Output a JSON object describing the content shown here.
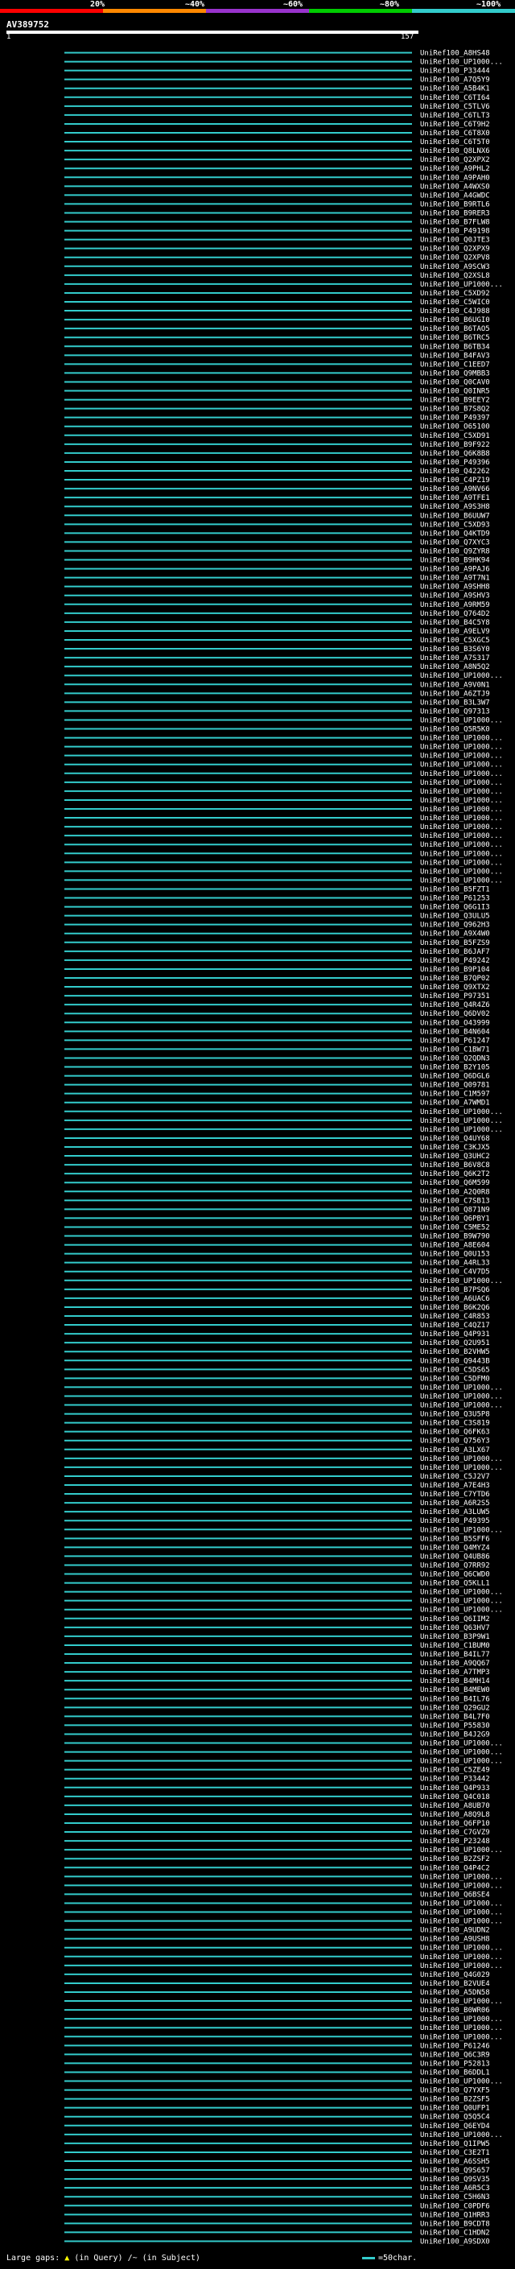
{
  "query": {
    "name": "AV389752",
    "start": "1",
    "end": "157"
  },
  "legend": {
    "labels": [
      "20%",
      "~40%",
      "~60%",
      "~80%",
      "~100%"
    ],
    "colors": [
      "#ff0000",
      "#ff8800",
      "#9933cc",
      "#00cc00",
      "#33cccc"
    ]
  },
  "chart_data": {
    "type": "alignment",
    "query_length": 157,
    "hits": [
      "UniRef100_A8HS48",
      "UniRef100_UP1000...",
      "UniRef100_P33444",
      "UniRef100_A7Q5Y9",
      "UniRef100_A5B4K1",
      "UniRef100_C6TI64",
      "UniRef100_C5TLV6",
      "UniRef100_C6TLT3",
      "UniRef100_C6T9H2",
      "UniRef100_C6T8X0",
      "UniRef100_C6T5T0",
      "UniRef100_Q8LNX6",
      "UniRef100_Q2XPX2",
      "UniRef100_A9PHL2",
      "UniRef100_A9PAH0",
      "UniRef100_A4WXS0",
      "UniRef100_A4GWDC",
      "UniRef100_B9RTL6",
      "UniRef100_B9RER3",
      "UniRef100_B7FLW8",
      "UniRef100_P49198",
      "UniRef100_Q0JTE3",
      "UniRef100_Q2XPX9",
      "UniRef100_Q2XPV8",
      "UniRef100_A9SCW3",
      "UniRef100_Q2XSL8",
      "UniRef100_UP1000...",
      "UniRef100_C5XD92",
      "UniRef100_C5WIC0",
      "UniRef100_C4J988",
      "UniRef100_B6UGI0",
      "UniRef100_B6TAO5",
      "UniRef100_B6TRC5",
      "UniRef100_B6TB34",
      "UniRef100_B4FAV3",
      "UniRef100_C1EED7",
      "UniRef100_Q9MBB3",
      "UniRef100_Q0CAV0",
      "UniRef100_Q0INR5",
      "UniRef100_B9EEY2",
      "UniRef100_B7S8Q2",
      "UniRef100_P49397",
      "UniRef100_O65100",
      "UniRef100_C5XD91",
      "UniRef100_B9F922",
      "UniRef100_Q6K8B8",
      "UniRef100_P49396",
      "UniRef100_Q42262",
      "UniRef100_C4PZ19",
      "UniRef100_A9NV66",
      "UniRef100_A9TFE1",
      "UniRef100_A9S3H8",
      "UniRef100_B6UUW7",
      "UniRef100_C5XD93",
      "UniRef100_Q4KTD9",
      "UniRef100_Q7XYC3",
      "UniRef100_Q9ZYR8",
      "UniRef100_B9HK94",
      "UniRef100_A9PAJ6",
      "UniRef100_A9T7N1",
      "UniRef100_A9SHH8",
      "UniRef100_A9SHV3",
      "UniRef100_A9RM59",
      "UniRef100_Q764D2",
      "UniRef100_B4C5Y8",
      "UniRef100_A9ELV9",
      "UniRef100_C5XGC5",
      "UniRef100_B3S6Y0",
      "UniRef100_A7S317",
      "UniRef100_A8N5Q2",
      "UniRef100_UP1000...",
      "UniRef100_A9V0N1",
      "UniRef100_A6ZTJ9",
      "UniRef100_B3L3W7",
      "UniRef100_Q97313",
      "UniRef100_UP1000...",
      "UniRef100_Q5R5K0",
      "UniRef100_UP1000...",
      "UniRef100_UP1000...",
      "UniRef100_UP1000...",
      "UniRef100_UP1000...",
      "UniRef100_UP1000...",
      "UniRef100_UP1000...",
      "UniRef100_UP1000...",
      "UniRef100_UP1000...",
      "UniRef100_UP1000...",
      "UniRef100_UP1000...",
      "UniRef100_UP1000...",
      "UniRef100_UP1000...",
      "UniRef100_UP1000...",
      "UniRef100_UP1000...",
      "UniRef100_UP1000...",
      "UniRef100_UP1000...",
      "UniRef100_UP1000...",
      "UniRef100_B5FZT1",
      "UniRef100_P61253",
      "UniRef100_Q6G1I3",
      "UniRef100_Q3ULU5",
      "UniRef100_Q962H3",
      "UniRef100_A9X4W0",
      "UniRef100_B5FZS9",
      "UniRef100_B6JAF7",
      "UniRef100_P49242",
      "UniRef100_B9P104",
      "UniRef100_B7QP02",
      "UniRef100_Q9XTX2",
      "UniRef100_P97351",
      "UniRef100_Q4R4Z6",
      "UniRef100_Q6DV02",
      "UniRef100_O43999",
      "UniRef100_B4N604",
      "UniRef100_P61247",
      "UniRef100_C1BW71",
      "UniRef100_Q2QDN3",
      "UniRef100_B2Y105",
      "UniRef100_Q6DGL6",
      "UniRef100_Q09781",
      "UniRef100_C1M597",
      "UniRef100_A7WMD1",
      "UniRef100_UP1000...",
      "UniRef100_UP1000...",
      "UniRef100_UP1000...",
      "UniRef100_Q4UY68",
      "UniRef100_C3KJX5",
      "UniRef100_Q3UHC2",
      "UniRef100_B6V8C8",
      "UniRef100_Q6K2T2",
      "UniRef100_Q6M599",
      "UniRef100_A2Q0R8",
      "UniRef100_C7SB13",
      "UniRef100_Q871N9",
      "UniRef100_Q6PBY1",
      "UniRef100_C5ME52",
      "UniRef100_B9W790",
      "UniRef100_A8E604",
      "UniRef100_Q0U153",
      "UniRef100_A4RL33",
      "UniRef100_C4V7D5",
      "UniRef100_UP1000...",
      "UniRef100_B7PSQ6",
      "UniRef100_A6UAC6",
      "UniRef100_B6K2Q6",
      "UniRef100_C4R853",
      "UniRef100_C4QZ17",
      "UniRef100_Q4P931",
      "UniRef100_Q2U951",
      "UniRef100_B2VHW5",
      "UniRef100_Q9443B",
      "UniRef100_C5DS65",
      "UniRef100_C5DFM0",
      "UniRef100_UP1000...",
      "UniRef100_UP1000...",
      "UniRef100_UP1000...",
      "UniRef100_Q3U5P8",
      "UniRef100_C3S819",
      "UniRef100_Q6FK63",
      "UniRef100_Q756Y3",
      "UniRef100_A3LX67",
      "UniRef100_UP1000...",
      "UniRef100_UP1000...",
      "UniRef100_C5J2V7",
      "UniRef100_A7E4H3",
      "UniRef100_C7YTD6",
      "UniRef100_A6R2S5",
      "UniRef100_A3LUW5",
      "UniRef100_P49395",
      "UniRef100_UP1000...",
      "UniRef100_B5SFF6",
      "UniRef100_Q4MYZ4",
      "UniRef100_Q4UB86",
      "UniRef100_Q7RR92",
      "UniRef100_Q6CWD0",
      "UniRef100_Q5KLL1",
      "UniRef100_UP1000...",
      "UniRef100_UP1000...",
      "UniRef100_UP1000...",
      "UniRef100_Q6IIM2",
      "UniRef100_Q63HV7",
      "UniRef100_B3P9W1",
      "UniRef100_C1BUM0",
      "UniRef100_B4IL77",
      "UniRef100_A9QQ67",
      "UniRef100_A7TMP3",
      "UniRef100_B4MH14",
      "UniRef100_B4MEW0",
      "UniRef100_B4IL76",
      "UniRef100_Q29GU2",
      "UniRef100_B4L7F0",
      "UniRef100_P55830",
      "UniRef100_B4J2G9",
      "UniRef100_UP1000...",
      "UniRef100_UP1000...",
      "UniRef100_UP1000...",
      "UniRef100_C5ZE49",
      "UniRef100_P33442",
      "UniRef100_Q4P933",
      "UniRef100_Q4C018",
      "UniRef100_A8UB70",
      "UniRef100_A8Q9L8",
      "UniRef100_Q6FP10",
      "UniRef100_C7GVZ9",
      "UniRef100_P23248",
      "UniRef100_UP1000...",
      "UniRef100_B2ZSF2",
      "UniRef100_Q4P4C2",
      "UniRef100_UP1000...",
      "UniRef100_UP1000...",
      "UniRef100_Q6BSE4",
      "UniRef100_UP1000...",
      "UniRef100_UP1000...",
      "UniRef100_UP1000...",
      "UniRef100_A9UDN2",
      "UniRef100_A9USH8",
      "UniRef100_UP1000...",
      "UniRef100_UP1000...",
      "UniRef100_UP1000...",
      "UniRef100_Q4G029",
      "UniRef100_B2VUE4",
      "UniRef100_A5DN58",
      "UniRef100_UP1000...",
      "UniRef100_B0WR06",
      "UniRef100_UP1000...",
      "UniRef100_UP1000...",
      "UniRef100_UP1000...",
      "UniRef100_P61246",
      "UniRef100_Q6C3R9",
      "UniRef100_P52813",
      "UniRef100_B6DDL1",
      "UniRef100_UP1000...",
      "UniRef100_Q7YXF5",
      "UniRef100_B2ZSF5",
      "UniRef100_Q0UFP1",
      "UniRef100_Q5Q5C4",
      "UniRef100_Q6EYD4",
      "UniRef100_UP1000...",
      "UniRef100_Q1IPW5",
      "UniRef100_C3E2T1",
      "UniRef100_A6SSH5",
      "UniRef100_Q9S657",
      "UniRef100_Q9SV35",
      "UniRef100_A6R5C3",
      "UniRef100_C5H6N3",
      "UniRef100_C0PDF6",
      "UniRef100_Q1HRR3",
      "UniRef100_B9CDT8",
      "UniRef100_C1HDN2",
      "UniRef100_A9SDX0"
    ]
  },
  "footer": {
    "large_gaps": "Large gaps:",
    "in_query": "(in Query)",
    "in_subject": "/~ (in Subject)",
    "scale": "=50char."
  }
}
